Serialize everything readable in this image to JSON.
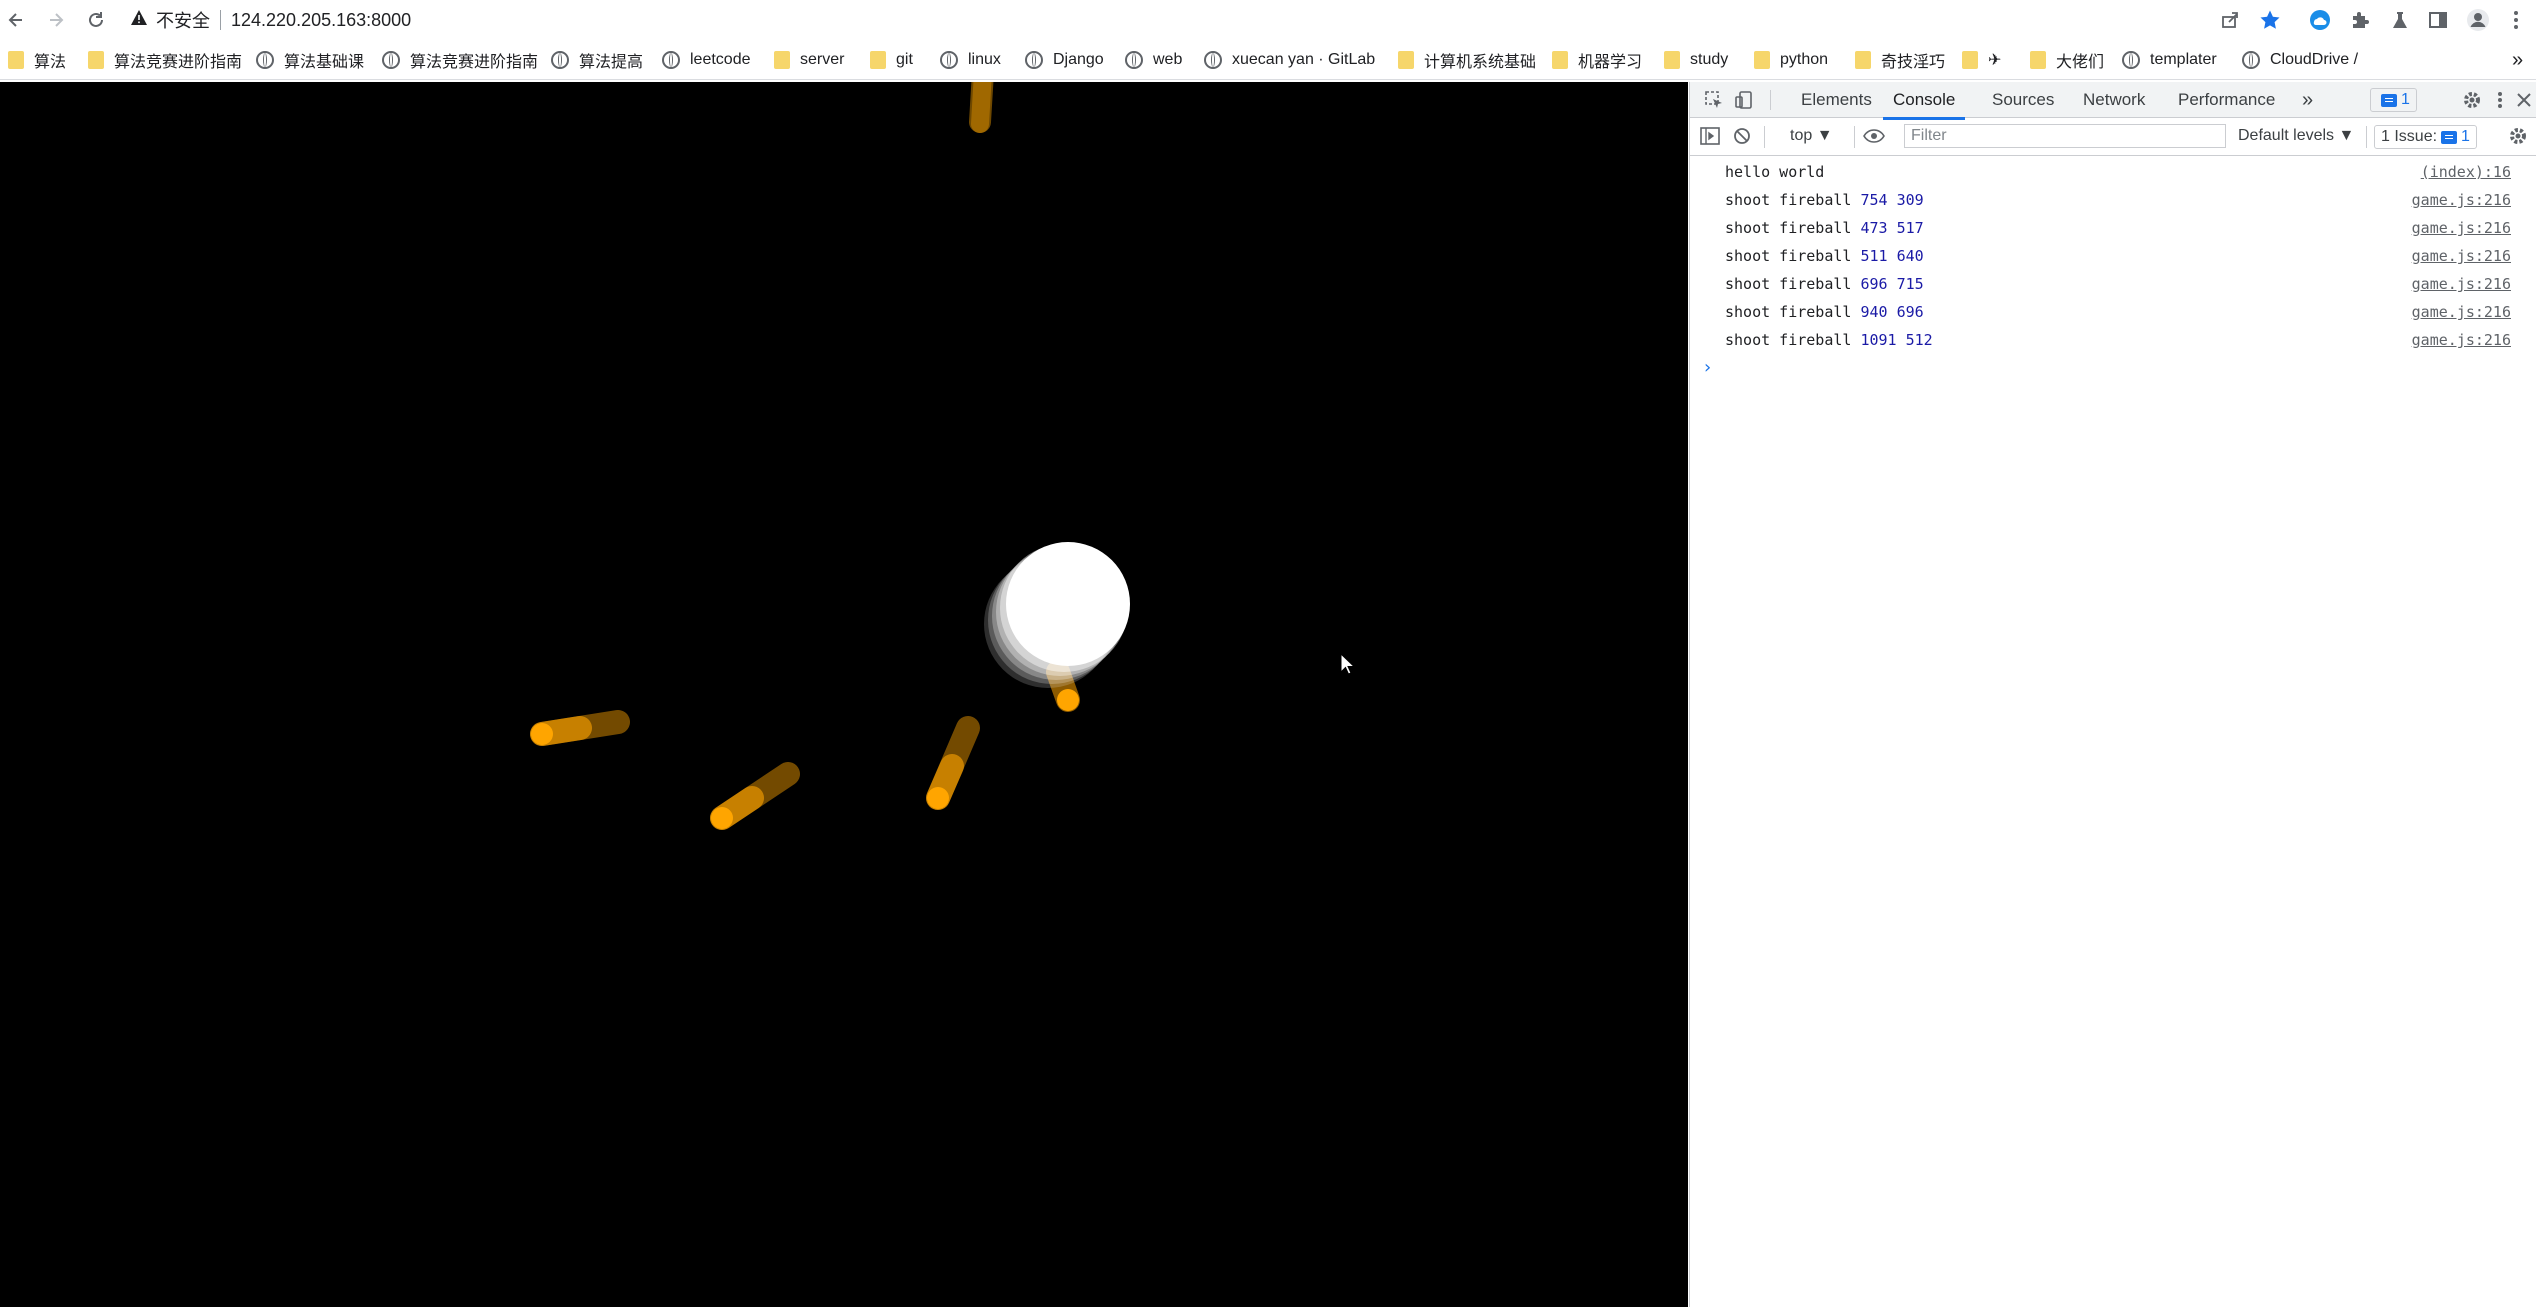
{
  "browser": {
    "security_label": "不安全",
    "url": "124.220.205.163:8000",
    "icons": [
      "back-icon",
      "forward-icon",
      "reload-icon",
      "share-icon",
      "star-icon",
      "cloud-extension-icon",
      "puzzle-extensions-icon",
      "labs-flask-icon",
      "side-panel-icon",
      "profile-icon",
      "menu-icon"
    ]
  },
  "bookmarks": [
    {
      "label": "算法",
      "icon": "folder"
    },
    {
      "label": "算法竞赛进阶指南",
      "icon": "folder"
    },
    {
      "label": "算法基础课",
      "icon": "globe"
    },
    {
      "label": "算法竞赛进阶指南",
      "icon": "globe"
    },
    {
      "label": "算法提高",
      "icon": "globe"
    },
    {
      "label": "leetcode",
      "icon": "globe"
    },
    {
      "label": "server",
      "icon": "folder"
    },
    {
      "label": "git",
      "icon": "folder"
    },
    {
      "label": "linux",
      "icon": "globe"
    },
    {
      "label": "Django",
      "icon": "globe"
    },
    {
      "label": "web",
      "icon": "globe"
    },
    {
      "label": "xuecan yan · GitLab",
      "icon": "globe"
    },
    {
      "label": "计算机系统基础",
      "icon": "folder"
    },
    {
      "label": "机器学习",
      "icon": "folder"
    },
    {
      "label": "study",
      "icon": "folder"
    },
    {
      "label": "python",
      "icon": "folder"
    },
    {
      "label": "奇技淫巧",
      "icon": "folder"
    },
    {
      "label": "✈",
      "icon": "folder"
    },
    {
      "label": "大佬们",
      "icon": "folder"
    },
    {
      "label": "templater",
      "icon": "globe"
    },
    {
      "label": "CloudDrive /",
      "icon": "globe"
    }
  ],
  "bookmarks_overflow": "»",
  "devtools": {
    "tabs": [
      "Elements",
      "Console",
      "Sources",
      "Network",
      "Performance"
    ],
    "active_tab": "Console",
    "more_tabs": "»",
    "message_count": "1",
    "context": "top ▼",
    "filter_placeholder": "Filter",
    "levels": "Default levels ▼",
    "issues": "1 Issue:",
    "issues_count": "1",
    "prompt": "›",
    "console": [
      {
        "text": "hello world",
        "n1": "",
        "n2": "",
        "source": "(index):16"
      },
      {
        "text": "shoot fireball",
        "n1": "754",
        "n2": "309",
        "source": "game.js:216"
      },
      {
        "text": "shoot fireball",
        "n1": "473",
        "n2": "517",
        "source": "game.js:216"
      },
      {
        "text": "shoot fireball",
        "n1": "511",
        "n2": "640",
        "source": "game.js:216"
      },
      {
        "text": "shoot fireball",
        "n1": "696",
        "n2": "715",
        "source": "game.js:216"
      },
      {
        "text": "shoot fireball",
        "n1": "940",
        "n2": "696",
        "source": "game.js:216"
      },
      {
        "text": "shoot fireball",
        "n1": "1091",
        "n2": "512",
        "source": "game.js:216"
      }
    ]
  },
  "game": {
    "background": "#000000",
    "player_color": "#ffffff",
    "fireball_color": "#ffa500"
  }
}
